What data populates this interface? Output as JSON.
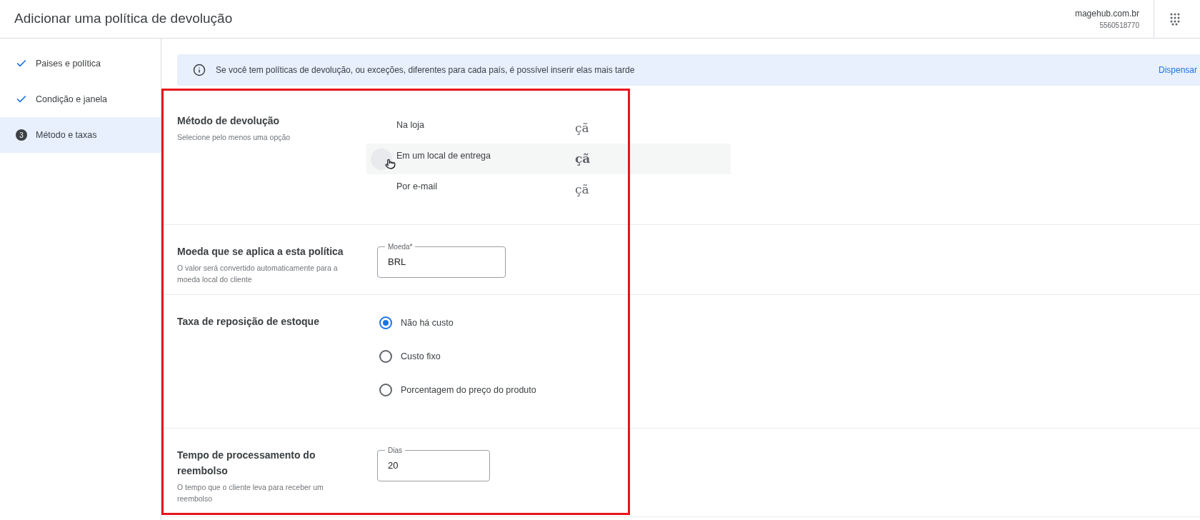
{
  "header": {
    "title": "Adicionar uma política de devolução",
    "account": {
      "domain": "magehub.com.br",
      "id": "5560518770"
    }
  },
  "steps": [
    {
      "label": "Paises e política",
      "done": true,
      "selected": false
    },
    {
      "label": "Condição e janela",
      "done": true,
      "selected": false
    },
    {
      "label": "Método e taxas",
      "done": false,
      "number": "3",
      "selected": true
    }
  ],
  "banner": {
    "text": "Se você tem políticas de devolução, ou exceções, diferentes para cada país, é possível inserir elas mais tarde",
    "action": "Dispensar"
  },
  "sections": [
    {
      "kind": "options",
      "title": "Método de devolução",
      "subtitle": "Selecione pelo menos uma opção",
      "options": [
        {
          "label": "Na loja",
          "mark": "çã",
          "hovered": false
        },
        {
          "label": "Em um local de entrega",
          "mark": "çã",
          "hovered": true
        },
        {
          "label": "Por e-mail",
          "mark": "çã",
          "hovered": false
        }
      ]
    },
    {
      "kind": "field",
      "title": "Moeda que se aplica a esta política",
      "subtitle": "O valor será convertido automaticamente para a moeda local do cliente",
      "field": {
        "label": "Moeda*",
        "value": "BRL"
      }
    },
    {
      "kind": "radio",
      "title": "Taxa de reposição de estoque",
      "options": [
        {
          "label": "Não há custo",
          "selected": true
        },
        {
          "label": "Custo fixo",
          "selected": false
        },
        {
          "label": "Porcentagem do preço do produto",
          "selected": false
        }
      ]
    },
    {
      "kind": "field",
      "title": "Tempo de processamento do reembolso",
      "subtitle": "O tempo que o cliente leva para receber um reembolso",
      "field": {
        "label": "Dias",
        "value": "20"
      }
    }
  ]
}
